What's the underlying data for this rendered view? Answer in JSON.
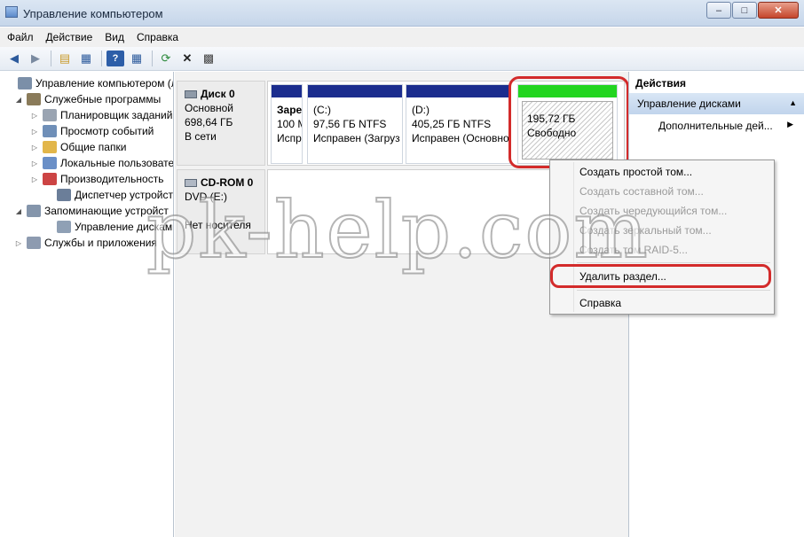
{
  "window": {
    "title": "Управление компьютером",
    "minimize": "–",
    "maximize": "□",
    "close": "✕"
  },
  "menu": [
    "Файл",
    "Действие",
    "Вид",
    "Справка"
  ],
  "tree": [
    {
      "label": "Управление компьютером (л",
      "exp": "",
      "icon": "computer-management-icon",
      "color": "#7b8fa8"
    },
    {
      "label": "Служебные программы",
      "exp": "◢",
      "icon": "tools-icon",
      "color": "#8a7b5a"
    },
    {
      "label": "Планировщик заданий",
      "exp": "▷",
      "icon": "clock-icon",
      "color": "#9aa4b2"
    },
    {
      "label": "Просмотр событий",
      "exp": "▷",
      "icon": "event-viewer-icon",
      "color": "#6f8fb8"
    },
    {
      "label": "Общие папки",
      "exp": "▷",
      "icon": "shared-folder-icon",
      "color": "#e2b64a"
    },
    {
      "label": "Локальные пользовате",
      "exp": "▷",
      "icon": "users-icon",
      "color": "#6a8fc7"
    },
    {
      "label": "Производительность",
      "exp": "▷",
      "icon": "performance-icon",
      "color": "#cc4444"
    },
    {
      "label": "Диспетчер устройств",
      "exp": "",
      "icon": "device-manager-icon",
      "color": "#6b7e99"
    },
    {
      "label": "Запоминающие устройст",
      "exp": "◢",
      "icon": "storage-icon",
      "color": "#8495ab"
    },
    {
      "label": "Управление дисками",
      "exp": "",
      "icon": "disk-management-icon",
      "color": "#8fa0b5"
    },
    {
      "label": "Службы и приложения",
      "exp": "▷",
      "icon": "services-icon",
      "color": "#8d9bb0"
    }
  ],
  "disk0": {
    "name": "Диск 0",
    "type": "Основной",
    "size": "698,64 ГБ",
    "status": "В сети",
    "partitions": [
      {
        "line1": "Заре",
        "line2": "100 М",
        "line3": "Испр"
      },
      {
        "line1": "(C:)",
        "line2": "97,56 ГБ NTFS",
        "line3": "Исправен (Загруз"
      },
      {
        "line1": "(D:)",
        "line2": "405,25 ГБ NTFS",
        "line3": "Исправен (Основно"
      },
      {
        "line1": "195,72 ГБ",
        "line2": "Свободно"
      }
    ]
  },
  "cdrom": {
    "name": "CD-ROM 0",
    "drive": "DVD (E:)",
    "status": "Нет носителя"
  },
  "actions": {
    "header": "Действия",
    "section": "Управление дисками",
    "more": "Дополнительные дей..."
  },
  "context_menu": {
    "items": [
      {
        "label": "Создать простой том...",
        "enabled": true
      },
      {
        "label": "Создать составной том...",
        "enabled": false
      },
      {
        "label": "Создать чередующийся том...",
        "enabled": false
      },
      {
        "label": "Создать зеркальный том...",
        "enabled": false
      },
      {
        "label": "Создать том RAID-5...",
        "enabled": false
      },
      {
        "label": "Удалить раздел...",
        "enabled": true
      },
      {
        "label": "Справка",
        "enabled": true
      }
    ]
  },
  "watermark": "pk-help.com",
  "colors": {
    "primary_partition": "#1b2d8e",
    "free_space": "#22d51f",
    "highlight": "#d32b2b"
  }
}
